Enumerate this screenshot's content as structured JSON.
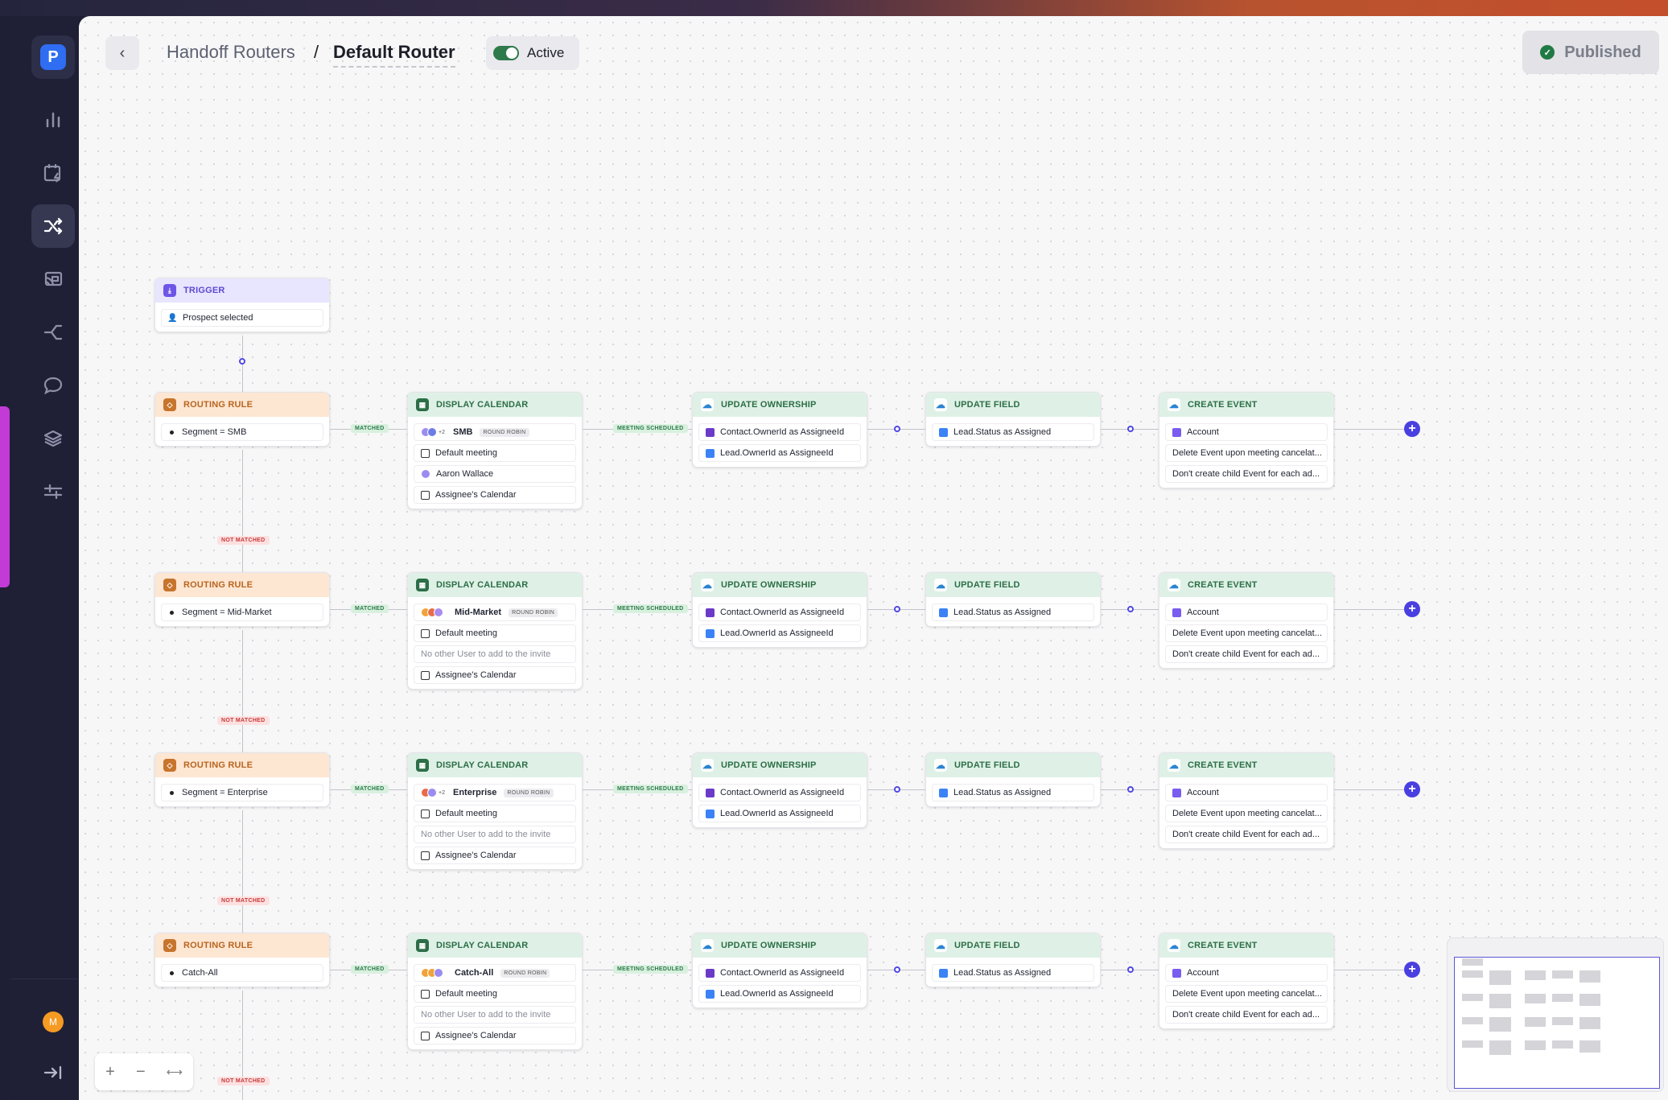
{
  "app": {
    "logo_letter": "P"
  },
  "sidebar": {
    "items": [
      {
        "name": "analytics-icon"
      },
      {
        "name": "calendar-bolt-icon"
      },
      {
        "name": "shuffle-icon",
        "active": true
      },
      {
        "name": "cast-icon"
      },
      {
        "name": "branch-icon"
      },
      {
        "name": "chat-icon"
      },
      {
        "name": "layers-icon"
      },
      {
        "name": "sliders-icon"
      }
    ],
    "user_initial": "M",
    "collapse_icon": "collapse-right-icon"
  },
  "header": {
    "back_icon": "chevron-left-icon",
    "breadcrumb_parent": "Handoff Routers",
    "breadcrumb_separator": "/",
    "title": "Default Router",
    "active_label": "Active",
    "active_on": true,
    "publish_label": "Published"
  },
  "trigger": {
    "label": "TRIGGER",
    "value": "Prospect selected"
  },
  "labels": {
    "routing_rule": "ROUTING RULE",
    "display_calendar": "DISPLAY CALENDAR",
    "update_ownership": "UPDATE OWNERSHIP",
    "update_field": "UPDATE FIELD",
    "create_event": "CREATE EVENT",
    "matched": "MATCHED",
    "meeting_scheduled": "MEETING SCHEDULED",
    "not_matched": "NOT MATCHED",
    "round_robin": "ROUND ROBIN",
    "plus_two": "+2"
  },
  "rows": [
    {
      "rule": "Segment = SMB",
      "calendar_team": "SMB",
      "meeting": "Default meeting",
      "attendee": "Aaron Wallace",
      "attendee_gray": false,
      "calendar": "Assignee's Calendar",
      "avatars_plus": true,
      "owner1": "Contact.OwnerId as AssigneeId",
      "owner2": "Lead.OwnerId as AssigneeId",
      "field": "Lead.Status as Assigned",
      "event1": "Account",
      "event2": "Delete Event upon meeting cancelat...",
      "event3": "Don't create child Event for each ad..."
    },
    {
      "rule": "Segment = Mid-Market",
      "calendar_team": "Mid-Market",
      "meeting": "Default meeting",
      "attendee": "No other User to add to the invite",
      "attendee_gray": true,
      "calendar": "Assignee's Calendar",
      "avatars_plus": false,
      "owner1": "Contact.OwnerId as AssigneeId",
      "owner2": "Lead.OwnerId as AssigneeId",
      "field": "Lead.Status as Assigned",
      "event1": "Account",
      "event2": "Delete Event upon meeting cancelat...",
      "event3": "Don't create child Event for each ad..."
    },
    {
      "rule": "Segment = Enterprise",
      "calendar_team": "Enterprise",
      "meeting": "Default meeting",
      "attendee": "No other User to add to the invite",
      "attendee_gray": true,
      "calendar": "Assignee's Calendar",
      "avatars_plus": true,
      "owner1": "Contact.OwnerId as AssigneeId",
      "owner2": "Lead.OwnerId as AssigneeId",
      "field": "Lead.Status as Assigned",
      "event1": "Account",
      "event2": "Delete Event upon meeting cancelat...",
      "event3": "Don't create child Event for each ad..."
    },
    {
      "rule": "Catch-All",
      "calendar_team": "Catch-All",
      "meeting": "Default meeting",
      "attendee": "No other User to add to the invite",
      "attendee_gray": true,
      "calendar": "Assignee's Calendar",
      "avatars_plus": false,
      "owner1": "Contact.OwnerId as AssigneeId",
      "owner2": "Lead.OwnerId as AssigneeId",
      "field": "Lead.Status as Assigned",
      "event1": "Account",
      "event2": "Delete Event upon meeting cancelat...",
      "event3": "Don't create child Event for each ad..."
    }
  ],
  "zoom_controls": {
    "zoom_in": "+",
    "zoom_out": "−",
    "fit": "⟷"
  },
  "colors": {
    "accent": "#4a3fe0",
    "active_toggle": "#2f7a4a",
    "brand": "#2f6df2"
  }
}
